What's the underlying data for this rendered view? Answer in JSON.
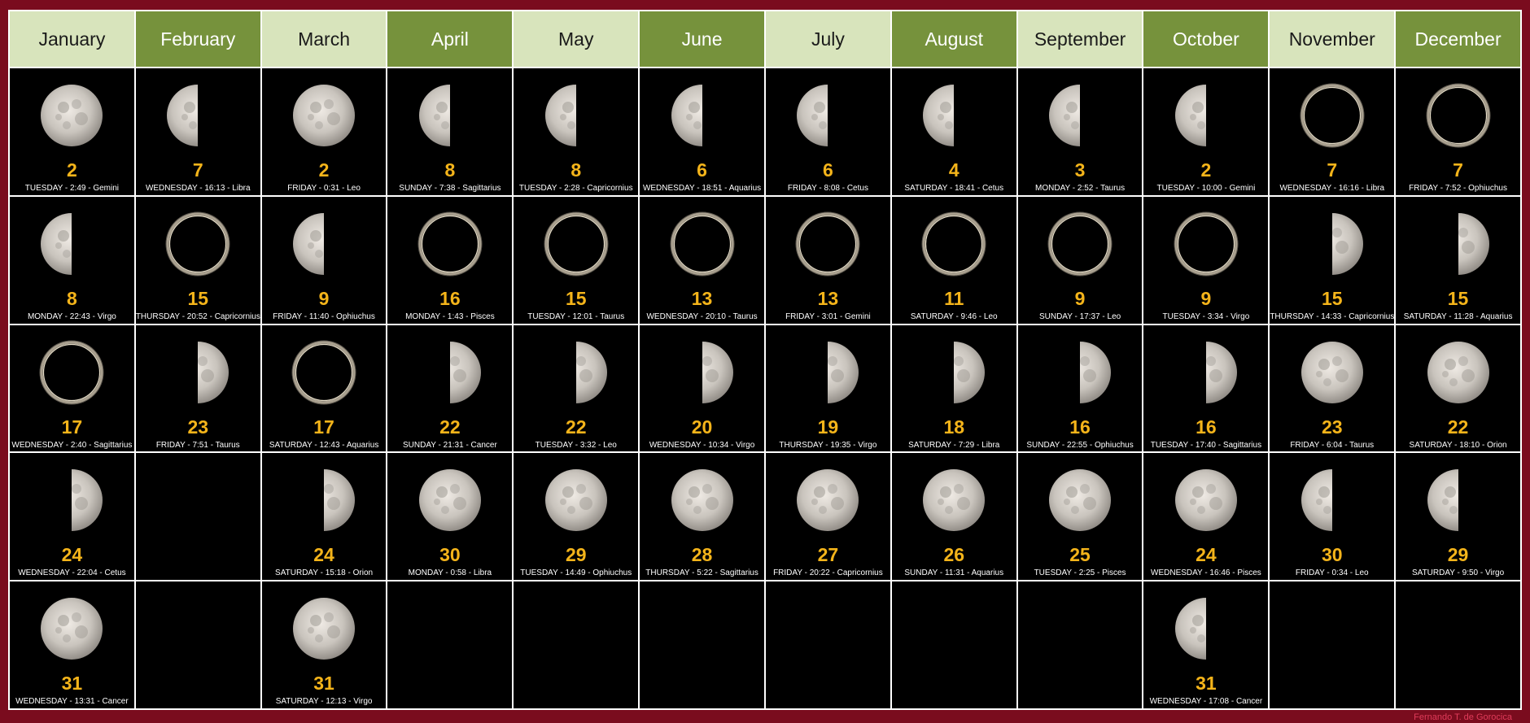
{
  "months": [
    "January",
    "February",
    "March",
    "April",
    "May",
    "June",
    "July",
    "August",
    "September",
    "October",
    "November",
    "December"
  ],
  "columns": [
    [
      {
        "phase": "full",
        "day": "2",
        "info": "TUESDAY - 2:49 - Gemini"
      },
      {
        "phase": "last",
        "day": "8",
        "info": "MONDAY - 22:43 - Virgo"
      },
      {
        "phase": "new",
        "day": "17",
        "info": "WEDNESDAY - 2:40 - Sagittarius"
      },
      {
        "phase": "first",
        "day": "24",
        "info": "WEDNESDAY - 22:04 - Cetus"
      },
      {
        "phase": "full",
        "day": "31",
        "info": "WEDNESDAY - 13:31 - Cancer"
      }
    ],
    [
      {
        "phase": "last",
        "day": "7",
        "info": "WEDNESDAY - 16:13 - Libra"
      },
      {
        "phase": "new",
        "day": "15",
        "info": "THURSDAY - 20:52 - Capricornius"
      },
      {
        "phase": "first",
        "day": "23",
        "info": "FRIDAY - 7:51 - Taurus"
      },
      null,
      null
    ],
    [
      {
        "phase": "full",
        "day": "2",
        "info": "FRIDAY - 0:31 - Leo"
      },
      {
        "phase": "last",
        "day": "9",
        "info": "FRIDAY - 11:40 - Ophiuchus"
      },
      {
        "phase": "new",
        "day": "17",
        "info": "SATURDAY - 12:43 - Aquarius"
      },
      {
        "phase": "first",
        "day": "24",
        "info": "SATURDAY - 15:18 - Orion"
      },
      {
        "phase": "full",
        "day": "31",
        "info": "SATURDAY - 12:13 - Virgo"
      }
    ],
    [
      {
        "phase": "last",
        "day": "8",
        "info": "SUNDAY - 7:38 - Sagittarius"
      },
      {
        "phase": "new",
        "day": "16",
        "info": "MONDAY - 1:43 - Pisces"
      },
      {
        "phase": "first",
        "day": "22",
        "info": "SUNDAY - 21:31 - Cancer"
      },
      {
        "phase": "full",
        "day": "30",
        "info": "MONDAY - 0:58 - Libra"
      },
      null
    ],
    [
      {
        "phase": "last",
        "day": "8",
        "info": "TUESDAY - 2:28 - Capricornius"
      },
      {
        "phase": "new",
        "day": "15",
        "info": "TUESDAY - 12:01 - Taurus"
      },
      {
        "phase": "first",
        "day": "22",
        "info": "TUESDAY - 3:32 - Leo"
      },
      {
        "phase": "full",
        "day": "29",
        "info": "TUESDAY - 14:49 - Ophiuchus"
      },
      null
    ],
    [
      {
        "phase": "last",
        "day": "6",
        "info": "WEDNESDAY - 18:51 - Aquarius"
      },
      {
        "phase": "new",
        "day": "13",
        "info": "WEDNESDAY - 20:10 - Taurus"
      },
      {
        "phase": "first",
        "day": "20",
        "info": "WEDNESDAY - 10:34 - Virgo"
      },
      {
        "phase": "full",
        "day": "28",
        "info": "THURSDAY - 5:22 - Sagittarius"
      },
      null
    ],
    [
      {
        "phase": "last",
        "day": "6",
        "info": "FRIDAY - 8:08 - Cetus"
      },
      {
        "phase": "new",
        "day": "13",
        "info": "FRIDAY - 3:01 - Gemini"
      },
      {
        "phase": "first",
        "day": "19",
        "info": "THURSDAY - 19:35 - Virgo"
      },
      {
        "phase": "full",
        "day": "27",
        "info": "FRIDAY - 20:22 - Capricornius"
      },
      null
    ],
    [
      {
        "phase": "last",
        "day": "4",
        "info": "SATURDAY - 18:41 - Cetus"
      },
      {
        "phase": "new",
        "day": "11",
        "info": "SATURDAY - 9:46 - Leo"
      },
      {
        "phase": "first",
        "day": "18",
        "info": "SATURDAY - 7:29 - Libra"
      },
      {
        "phase": "full",
        "day": "26",
        "info": "SUNDAY - 11:31 - Aquarius"
      },
      null
    ],
    [
      {
        "phase": "last",
        "day": "3",
        "info": "MONDAY - 2:52 - Taurus"
      },
      {
        "phase": "new",
        "day": "9",
        "info": "SUNDAY - 17:37 - Leo"
      },
      {
        "phase": "first",
        "day": "16",
        "info": "SUNDAY - 22:55 - Ophiuchus"
      },
      {
        "phase": "full",
        "day": "25",
        "info": "TUESDAY - 2:25 - Pisces"
      },
      null
    ],
    [
      {
        "phase": "last",
        "day": "2",
        "info": "TUESDAY - 10:00 - Gemini"
      },
      {
        "phase": "new",
        "day": "9",
        "info": "TUESDAY - 3:34 - Virgo"
      },
      {
        "phase": "first",
        "day": "16",
        "info": "TUESDAY - 17:40 - Sagittarius"
      },
      {
        "phase": "full",
        "day": "24",
        "info": "WEDNESDAY - 16:46 - Pisces"
      },
      {
        "phase": "last",
        "day": "31",
        "info": "WEDNESDAY - 17:08 - Cancer"
      }
    ],
    [
      {
        "phase": "new",
        "day": "7",
        "info": "WEDNESDAY - 16:16 - Libra"
      },
      {
        "phase": "first",
        "day": "15",
        "info": "THURSDAY - 14:33 - Capricornius"
      },
      {
        "phase": "full",
        "day": "23",
        "info": "FRIDAY - 6:04 - Taurus"
      },
      {
        "phase": "last",
        "day": "30",
        "info": "FRIDAY - 0:34 - Leo"
      },
      null
    ],
    [
      {
        "phase": "new",
        "day": "7",
        "info": "FRIDAY - 7:52 - Ophiuchus"
      },
      {
        "phase": "first",
        "day": "15",
        "info": "SATURDAY - 11:28 - Aquarius"
      },
      {
        "phase": "full",
        "day": "22",
        "info": "SATURDAY - 18:10 - Orion"
      },
      {
        "phase": "last",
        "day": "29",
        "info": "SATURDAY - 9:50 - Virgo"
      },
      null
    ]
  ],
  "credit": "Fernando T. de Gorocica",
  "colors": {
    "frame": "#7a0c1e",
    "header_light": "#d8e4bc",
    "header_dark": "#76923c",
    "day_number": "#f4b41a"
  }
}
